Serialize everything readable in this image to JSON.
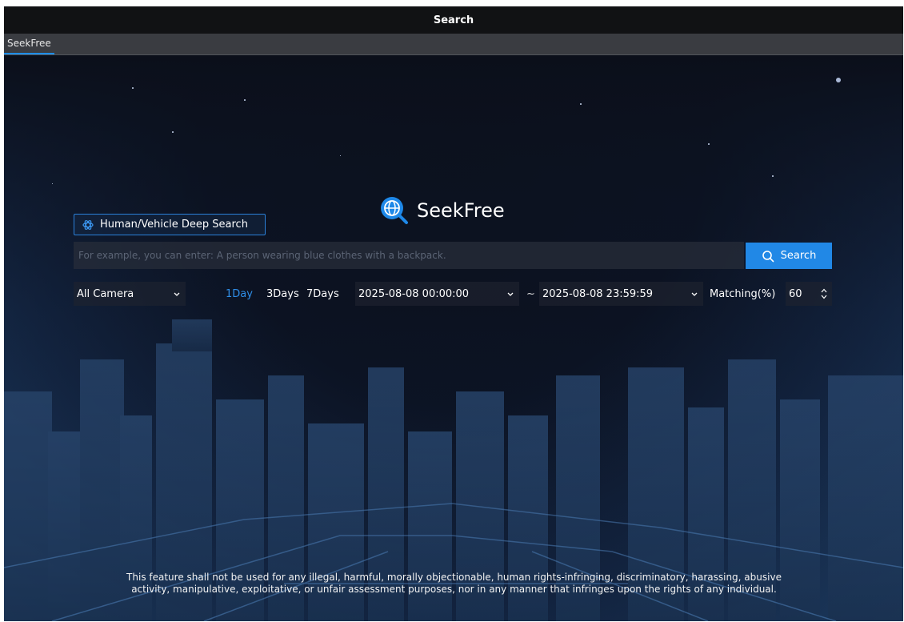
{
  "window": {
    "title": "Search"
  },
  "tabs": [
    {
      "label": "SeekFree"
    }
  ],
  "brand": {
    "name": "SeekFree",
    "accent": "#2188e6"
  },
  "deep_search": {
    "label": "Human/Vehicle Deep Search",
    "icon": "atom-icon"
  },
  "search": {
    "placeholder": "For example, you can enter: A person wearing blue clothes with a backpack.",
    "value": "",
    "button_label": "Search",
    "button_icon": "search-icon"
  },
  "filters": {
    "camera": "All Camera",
    "periods": [
      {
        "label": "1Day",
        "active": true
      },
      {
        "label": "3Days",
        "active": false
      },
      {
        "label": "7Days",
        "active": false
      }
    ],
    "start_time": "2025-08-08 00:00:00",
    "separator": "~",
    "end_time": "2025-08-08 23:59:59",
    "matching_label": "Matching(%)",
    "matching_value": "60"
  },
  "disclaimer": "This feature shall not be used for any illegal, harmful, morally objectionable, human rights-infringing, discriminatory, harassing, abusive activity, manipulative, exploitative, or unfair assessment purposes, nor in any manner that infringes upon the rights of any individual."
}
